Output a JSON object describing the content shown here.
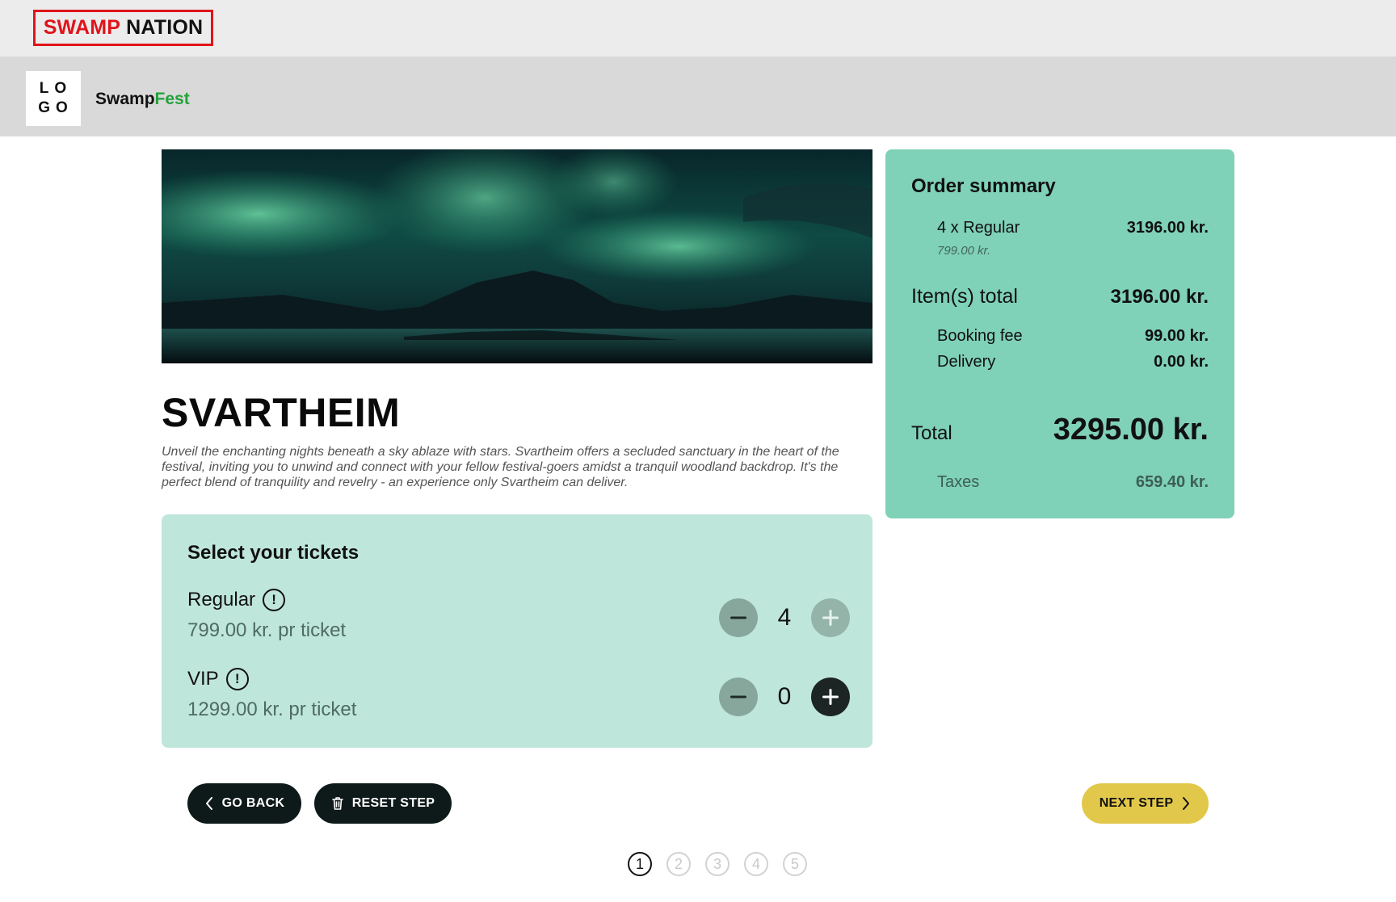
{
  "brand": {
    "word1": "SWAMP",
    "word2": "NATION"
  },
  "header": {
    "logo_line1": "LO",
    "logo_line2": "GO",
    "site_name_part1": "Swamp",
    "site_name_part2": "Fest"
  },
  "event": {
    "title": "SVARTHEIM",
    "description": "Unveil the enchanting nights beneath a sky ablaze with stars. Svartheim offers a secluded sanctuary in the heart of the festival, inviting you to unwind and connect with your fellow festival-goers amidst a tranquil woodland backdrop. It's the perfect blend of tranquility and revelry - an experience only Svartheim can deliver."
  },
  "tickets": {
    "title": "Select your tickets",
    "items": [
      {
        "name": "Regular",
        "price": "799.00 kr. pr ticket",
        "quantity": "4",
        "info_icon": "!"
      },
      {
        "name": "VIP",
        "price": "1299.00 kr. pr ticket",
        "quantity": "0",
        "info_icon": "!"
      }
    ]
  },
  "summary": {
    "title": "Order summary",
    "line_item": {
      "label": "4 x Regular",
      "value": "3196.00 kr.",
      "unit_price": "799.00 kr."
    },
    "items_total": {
      "label": "Item(s) total",
      "value": "3196.00 kr."
    },
    "booking_fee": {
      "label": "Booking fee",
      "value": "99.00 kr."
    },
    "delivery": {
      "label": "Delivery",
      "value": "0.00 kr."
    },
    "total": {
      "label": "Total",
      "value": "3295.00 kr."
    },
    "taxes": {
      "label": "Taxes",
      "value": "659.40 kr."
    }
  },
  "actions": {
    "go_back": "GO BACK",
    "reset_step": "RESET STEP",
    "next_step": "NEXT STEP"
  },
  "pager": {
    "pages": [
      "1",
      "2",
      "3",
      "4",
      "5"
    ],
    "current": "1"
  },
  "colors": {
    "brand_red": "#e0141b",
    "brand_green": "#22a33a",
    "summary_bg": "#7fd1b7",
    "tickets_bg": "#bfe6da",
    "next_button": "#e2c84a",
    "dark_button": "#0e1a19"
  },
  "icons": {
    "minus": "minus-icon",
    "plus": "plus-icon",
    "info": "info-icon",
    "chevron_left": "chevron-left-icon",
    "chevron_right": "chevron-right-icon",
    "trash": "trash-icon"
  }
}
